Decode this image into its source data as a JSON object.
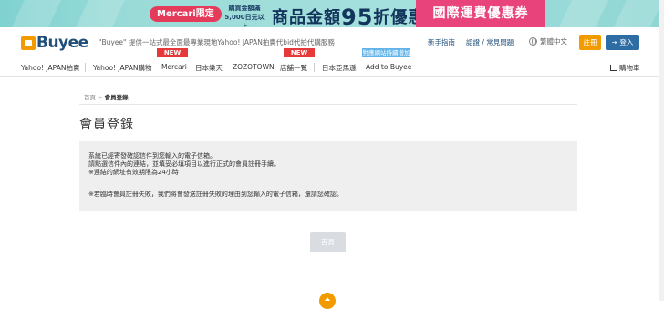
{
  "banner": {
    "pill": "Mercari限定",
    "note_line1": "購買金額滿",
    "note_line2": "5,000日元以上",
    "big_prefix": "商品金額",
    "big_number": "95",
    "big_suffix": "折優惠",
    "shipping": "國際運費優惠券"
  },
  "header": {
    "logo": "Buyee",
    "tagline": "\"Buyee\" 提供一站式最全面最專業現地Yahoo! JAPAN拍賣代bid代拍代購服務",
    "links": [
      "新手指南",
      "認證 / 常見問題"
    ],
    "language": "繁體中文",
    "register": "註冊",
    "login": "登入"
  },
  "nav": {
    "items": [
      "Yahoo! JAPAN拍賣",
      "Yahoo! JAPAN購物",
      "Mercari",
      "日本樂天",
      "ZOZOTOWN",
      "店舖一覧",
      "日本亞馬遜",
      "Add to Buyee"
    ],
    "badges": {
      "new": "NEW",
      "blue": "對應網站持續增加中"
    },
    "cart": "購物車"
  },
  "breadcrumb": {
    "home": "首頁",
    "separator": ">",
    "current": "會員登錄"
  },
  "page": {
    "title": "會員登錄",
    "lines": [
      "系統已經寄發確認信件到您輸入的電子信箱。",
      "請點選信件內的連結，並填妥必填項目以進行正式的會員註冊手續。",
      "※連結的網址有效期限為24小時",
      "※若臨時會員註冊失敗，我們將會發送註冊失敗的理由到您輸入的電子信箱，還請您確認。"
    ],
    "home_button": "首頁"
  },
  "colors": {
    "orange": "#f29b00",
    "blue": "#2d6da3",
    "new_red": "#e63a3a",
    "pink": "#e8447b"
  }
}
